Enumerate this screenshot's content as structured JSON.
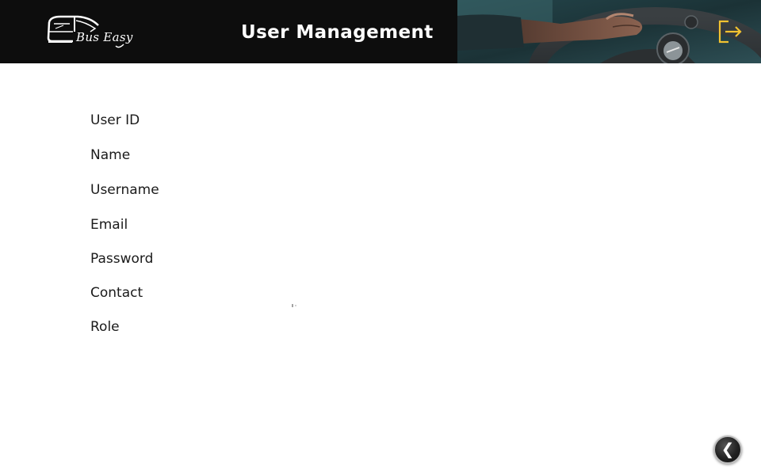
{
  "header": {
    "logo_text": "Bus Easy",
    "page_title": "User Management",
    "logout_icon": "logout-icon"
  },
  "form": {
    "fields": [
      {
        "label": "User ID"
      },
      {
        "label": "Name"
      },
      {
        "label": "Username"
      },
      {
        "label": "Email"
      },
      {
        "label": "Password"
      },
      {
        "label": "Contact"
      },
      {
        "label": "Role"
      }
    ]
  },
  "back_button": {
    "glyph": "❮",
    "icon": "chevron-left-icon"
  },
  "colors": {
    "header_bg": "#0d0d0d",
    "accent": "#f2c230",
    "text": "#1a1a1a"
  }
}
